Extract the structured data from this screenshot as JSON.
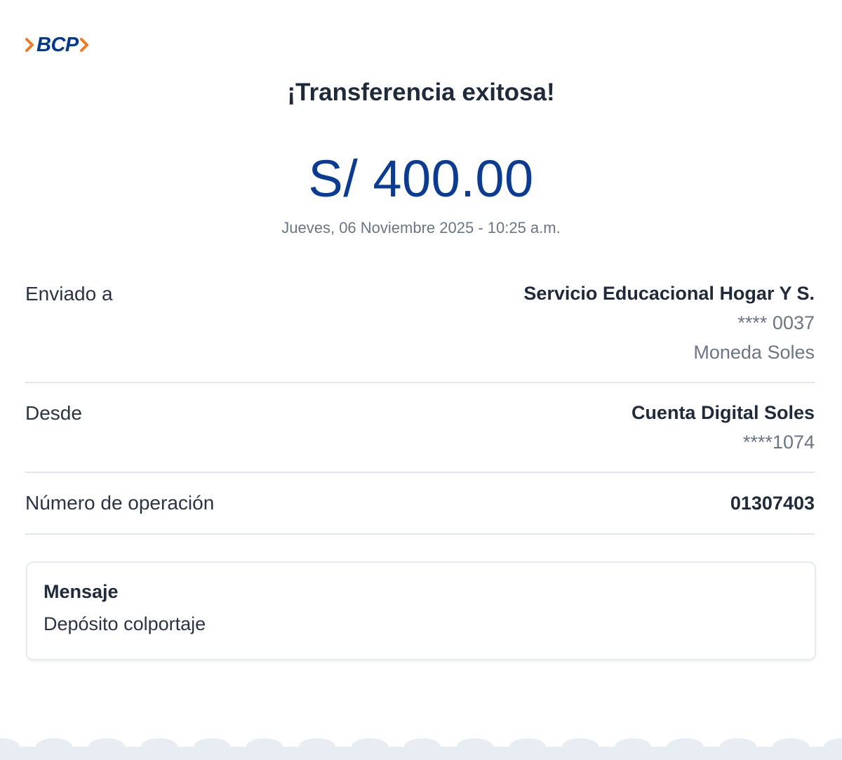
{
  "brand": {
    "name": "BCP",
    "accent": "#f47b20",
    "primary": "#003a8f"
  },
  "receipt": {
    "title": "¡Transferencia exitosa!",
    "amount": "S/ 400.00",
    "datetime": "Jueves, 06 Noviembre 2025 - 10:25 a.m."
  },
  "details": {
    "sent_to": {
      "label": "Enviado a",
      "name": "Servicio Educacional Hogar Y S.",
      "account": "**** 0037",
      "currency": "Moneda Soles"
    },
    "from": {
      "label": "Desde",
      "account_name": "Cuenta Digital Soles",
      "account_number": "****1074"
    },
    "operation": {
      "label": "Número de operación",
      "number": "01307403"
    }
  },
  "message": {
    "title": "Mensaje",
    "text": "Depósito colportaje"
  },
  "colors": {
    "amount": "#0a3c96",
    "divider": "#e2e6ec",
    "footer": "#e8edf4"
  }
}
